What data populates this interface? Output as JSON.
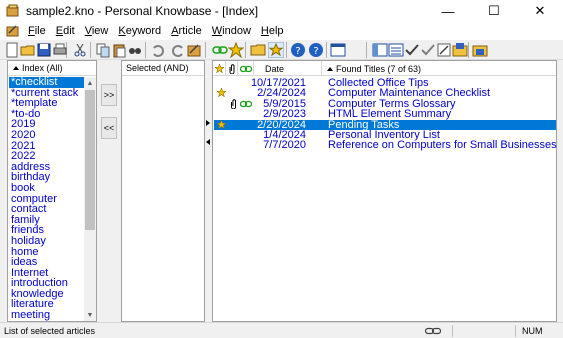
{
  "window": {
    "title": "sample2.kno - Personal Knowbase - [Index]",
    "controls": {
      "minimize": "—",
      "maximize": "☐",
      "close": "✕"
    }
  },
  "menu": {
    "items": [
      {
        "label": "File",
        "key": "F",
        "rest": "ile"
      },
      {
        "label": "Edit",
        "key": "E",
        "rest": "dit"
      },
      {
        "label": "View",
        "key": "V",
        "rest": "iew"
      },
      {
        "label": "Keyword",
        "key": "K",
        "rest": "eyword"
      },
      {
        "label": "Article",
        "key": "A",
        "rest": "rticle"
      },
      {
        "label": "Window",
        "key": "W",
        "rest": "indow"
      },
      {
        "label": "Help",
        "key": "H",
        "rest": "elp"
      }
    ]
  },
  "toolbar": {
    "icons": [
      "new-icon",
      "open-icon",
      "save-icon",
      "print-icon",
      "cut-icon",
      "copy-icon",
      "paste-icon",
      "find-icon",
      "undo-icon",
      "redo-icon",
      "article-icon",
      "link-icon",
      "star-icon",
      "folder-icon",
      "favorite-filter-icon",
      "help-icon",
      "about-icon",
      "panes-icon",
      "layout-icon",
      "list-icon",
      "check-icon",
      "spell-icon",
      "edit-icon",
      "export-icon",
      "import-icon"
    ]
  },
  "index": {
    "header": "Index (All)",
    "items": [
      "*checklist",
      "*current stack",
      "*template",
      "*to-do",
      "2019",
      "2020",
      "2021",
      "2022",
      "address",
      "birthday",
      "book",
      "computer",
      "contact",
      "family",
      "friends",
      "holiday",
      "home",
      "ideas",
      "Internet",
      "introduction",
      "knowledge",
      "literature",
      "meeting"
    ],
    "selected_index": 0
  },
  "buttons": {
    "add": ">>",
    "remove": "<<"
  },
  "selected": {
    "header": "Selected (AND)"
  },
  "results": {
    "columns": {
      "date": "Date",
      "titles": "Found Titles (7 of 63)"
    },
    "rows": [
      {
        "date": "10/17/2021",
        "title": "Collected Office Tips",
        "star": false,
        "clip": false,
        "link": false,
        "selected": false
      },
      {
        "date": "2/24/2024",
        "title": "Computer Maintenance Checklist",
        "star": true,
        "clip": false,
        "link": false,
        "selected": false
      },
      {
        "date": "5/9/2015",
        "title": "Computer Terms Glossary",
        "star": false,
        "clip": true,
        "link": true,
        "selected": false
      },
      {
        "date": "2/9/2023",
        "title": "HTML Element Summary",
        "star": false,
        "clip": false,
        "link": false,
        "selected": false
      },
      {
        "date": "2/20/2024",
        "title": "Pending Tasks",
        "star": true,
        "clip": false,
        "link": false,
        "selected": true
      },
      {
        "date": "1/4/2024",
        "title": "Personal Inventory List",
        "star": false,
        "clip": false,
        "link": false,
        "selected": false
      },
      {
        "date": "7/7/2020",
        "title": "Reference on Computers for Small Businesses",
        "star": false,
        "clip": false,
        "link": false,
        "selected": false
      }
    ]
  },
  "status": {
    "message": "List of selected articles",
    "num": "NUM"
  },
  "colors": {
    "accent": "#0078d7",
    "link_text": "#0000c8",
    "star": "#f2c200"
  }
}
